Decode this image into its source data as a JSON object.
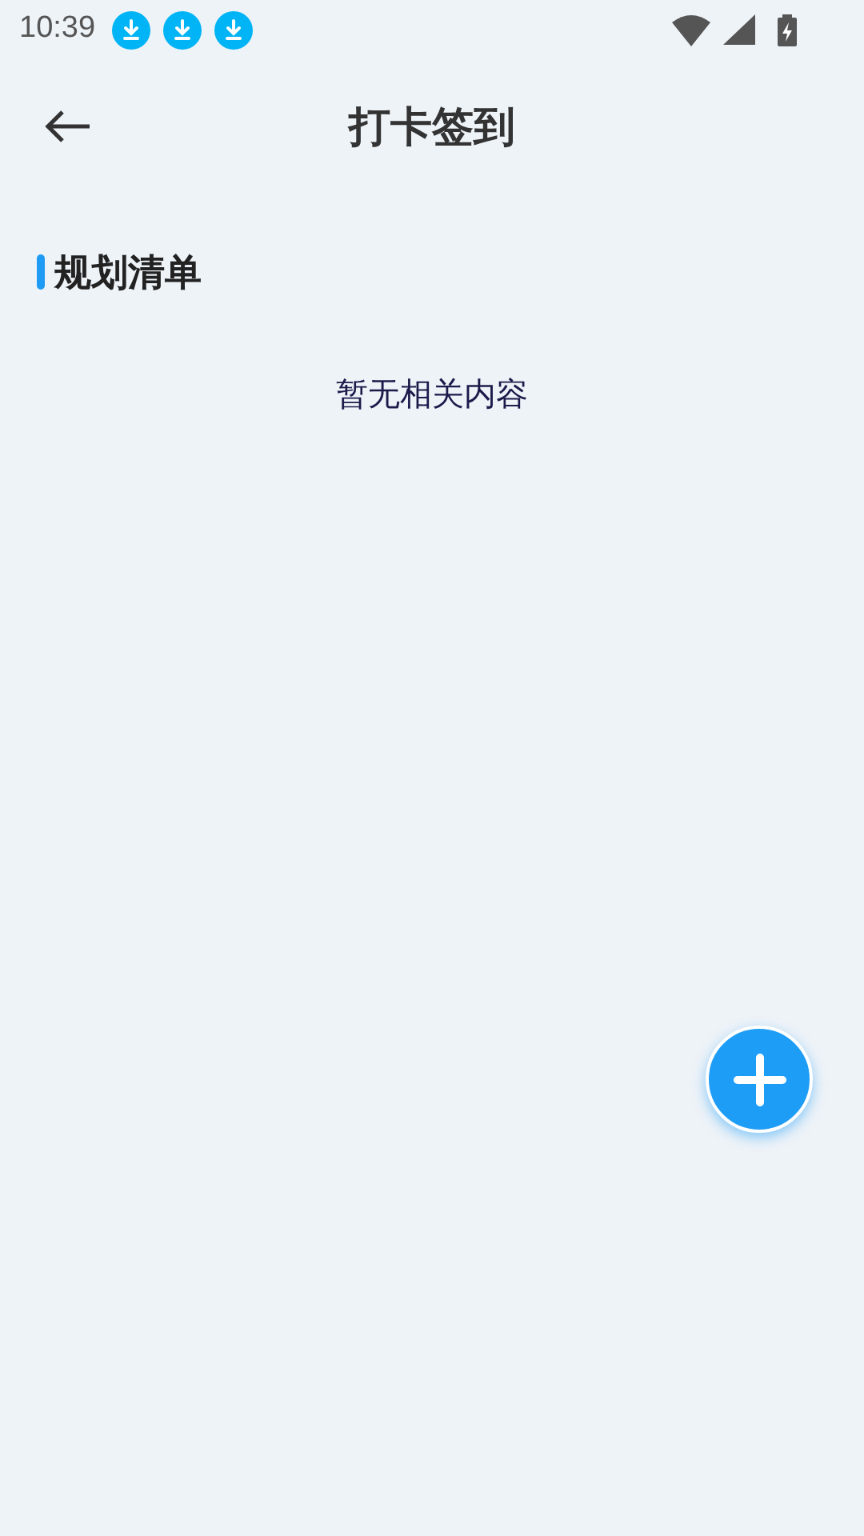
{
  "status_bar": {
    "time": "10:39",
    "notifications": [
      {
        "kind": "download"
      },
      {
        "kind": "download"
      },
      {
        "kind": "download"
      }
    ]
  },
  "header": {
    "title": "打卡签到"
  },
  "section": {
    "title": "规划清单",
    "empty_text": "暂无相关内容"
  }
}
